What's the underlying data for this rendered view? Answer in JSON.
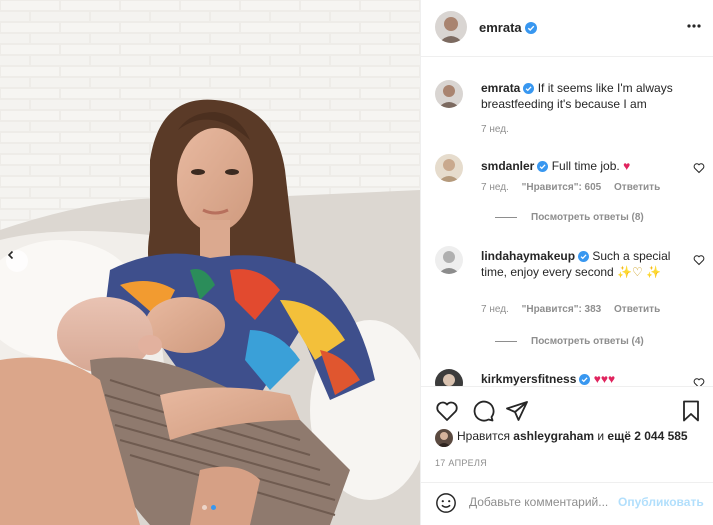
{
  "post": {
    "username": "emrata",
    "date": "17 АПРЕЛЯ"
  },
  "caption": {
    "username": "emrata",
    "text": "If it seems like I'm always breastfeeding it's because I am",
    "age": "7 нед."
  },
  "comments": [
    {
      "username": "smdanler",
      "text": "Full time job.",
      "emoji": "♥",
      "age": "7 нед.",
      "likes": "\"Нравится\": 605",
      "reply_label": "Ответить",
      "view_replies": "Посмотреть ответы (8)"
    },
    {
      "username": "lindahaymakeup",
      "text": "Such a special time, enjoy every second",
      "emoji": "✨♡ ✨",
      "age": "7 нед.",
      "likes": "\"Нравится\": 383",
      "reply_label": "Ответить",
      "view_replies": "Посмотреть ответы (4)"
    },
    {
      "username": "kirkmyersfitness",
      "emoji": "♥♥♥"
    }
  ],
  "likes": {
    "prefix": "Нравится",
    "user": "ashleygraham",
    "middle": "и",
    "count": "ещё 2 044 585"
  },
  "add_comment": {
    "placeholder": "Добавьте комментарий...",
    "publish_label": "Опубликовать"
  },
  "colors": {
    "verified": "#3897f0",
    "heart_red": "#e0245e",
    "publish_disabled": "#b2dffc",
    "carousel_active": "#3897f0"
  },
  "icons": [
    "chevron-left-icon",
    "more-icon",
    "verified-icon",
    "heart-icon",
    "comment-icon",
    "share-icon",
    "bookmark-icon",
    "smile-icon"
  ]
}
